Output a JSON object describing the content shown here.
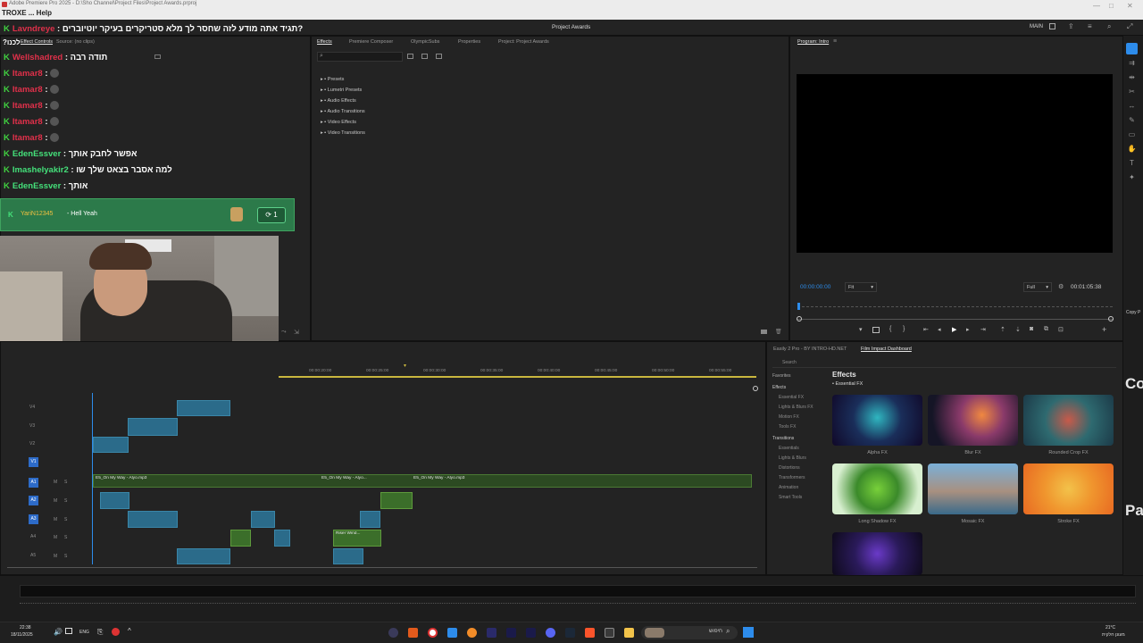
{
  "window": {
    "title_path": "Adobe Premiere Pro 2025 - D:\\Sho Channel\\Project Files\\Project Awards.prproj",
    "menu_hint": "TROXE ... Help",
    "center_title": "Project Awards",
    "workspace": "MAIN"
  },
  "chat": {
    "messages": [
      {
        "user": "Lavndreye",
        "text": "תגיד אתה מודע לזה שחסר לך מלא סטריקרים בעיקר יוטיוברים?",
        "color": "#e0304a"
      },
      {
        "user": "Wellshadred",
        "text": "תודה רבה",
        "color": "#e0304a"
      },
      {
        "user": "Itamar8",
        "text": "",
        "color": "#e0304a"
      },
      {
        "user": "Itamar8",
        "text": "",
        "color": "#e0304a"
      },
      {
        "user": "Itamar8",
        "text": "",
        "color": "#e0304a"
      },
      {
        "user": "Itamar8",
        "text": "",
        "color": "#e0304a"
      },
      {
        "user": "Itamar8",
        "text": "",
        "color": "#e0304a"
      },
      {
        "user": "EdenEssver",
        "text": "אפשר לחבק אותך",
        "color": "#44e07a"
      },
      {
        "user": "Imashelyakir2",
        "text": "למה אסבר בצאט שלך שו",
        "color": "#44e07a"
      },
      {
        "user": "EdenEssver",
        "text": "אותך",
        "color": "#44e07a"
      }
    ],
    "alert": {
      "user": "YariN12345",
      "text": "- Hell Yeah",
      "count": "1"
    },
    "left_tabs": [
      "Effect Controls",
      "Source: (no clips)"
    ]
  },
  "effects_panel": {
    "tabs": [
      "Effects",
      "Premiere Composer",
      "OlympicSubs",
      "Properties",
      "Project: Project Awards"
    ],
    "tree": [
      "Presets",
      "Lumetri Presets",
      "Audio Effects",
      "Audio Transitions",
      "Video Effects",
      "Video Transitions"
    ]
  },
  "program_monitor": {
    "title": "Program: Intro",
    "timecode_left": "00:00:00:00",
    "fit": "Fit",
    "quality": "Full",
    "timecode_right": "00:01:05:38"
  },
  "timeline": {
    "ruler": [
      "00:00:20:00",
      "00:00:25:00",
      "00:00:30:00",
      "00:00:35:00",
      "00:00:40:00",
      "00:00:45:00",
      "00:00:50:00",
      "00:00:55:00"
    ],
    "video_tracks": [
      "V4",
      "V3",
      "V2",
      "V1"
    ],
    "audio_tracks": [
      "A1",
      "A2",
      "A3",
      "A4",
      "A5"
    ],
    "audio_clips": [
      "E5_On My Way - Alyo.mp3",
      "E5_On My Way - Alyo...",
      "E5_On My Way - Alyo.mp3"
    ],
    "riser_label": "Riser Wind...",
    "track_letters": {
      "mute": "M",
      "solo": "S"
    }
  },
  "fx_panel": {
    "tabs": [
      "Easily 2 Pro - BY INTRO-HD.NET",
      "Film Impact Dashboard"
    ],
    "search_placeholder": "Search",
    "sidebar": [
      "Favorites",
      "Effects",
      "Essential FX",
      "Lights & Blurs FX",
      "Motion FX",
      "Tools FX",
      "Transitions",
      "Essentials",
      "Lights & Blurs",
      "Distortions",
      "Transformers",
      "Animation",
      "Smart Tools"
    ],
    "heading": "Effects",
    "subheading": "• Essential FX",
    "tiles": [
      "Alpha FX",
      "Blur FX",
      "Rounded Crop FX",
      "Long Shadow FX",
      "Mosaic FX",
      "Stroke FX",
      ""
    ]
  },
  "right_edge": {
    "copy": "Copy P",
    "co": "Co",
    "pa": "Pa"
  },
  "taskbar": {
    "time": "22:38",
    "date": "18/11/2025",
    "lang": "ENG",
    "search": "חיפוש",
    "weather_temp": "21°C",
    "weather_text": "מעונן חלקית"
  },
  "colors": {
    "accent": "#2d8ceb",
    "chat_green": "#44e07a",
    "chat_red": "#e0304a",
    "alert_bg": "#2c7a4a"
  }
}
